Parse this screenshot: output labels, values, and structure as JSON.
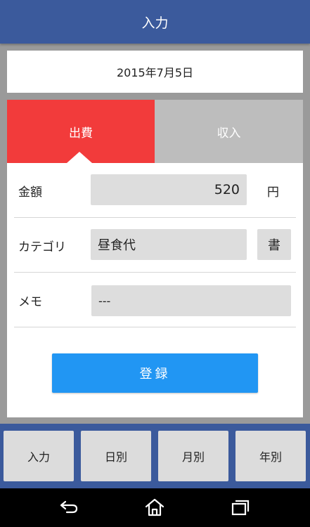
{
  "header": {
    "title": "入力"
  },
  "date": {
    "value": "2015年7月5日"
  },
  "tabs": {
    "expense_label": "出費",
    "income_label": "収入",
    "active": "expense"
  },
  "form": {
    "amount": {
      "label": "金額",
      "value": "520",
      "unit": "円"
    },
    "category": {
      "label": "カテゴリ",
      "value": "昼食代",
      "book_label": "書"
    },
    "memo": {
      "label": "メモ",
      "value": "---"
    },
    "register_label": "登録"
  },
  "bottom_nav": [
    {
      "label": "入力"
    },
    {
      "label": "日別"
    },
    {
      "label": "月別"
    },
    {
      "label": "年別"
    }
  ],
  "system_nav": {
    "icons": [
      "back-icon",
      "home-icon",
      "recent-apps-icon"
    ]
  },
  "colors": {
    "header": "#3b5a9c",
    "expense_tab": "#f23b3b",
    "income_tab": "#bdbdbd",
    "register_button": "#2196f3",
    "field_bg": "#dddddd"
  }
}
